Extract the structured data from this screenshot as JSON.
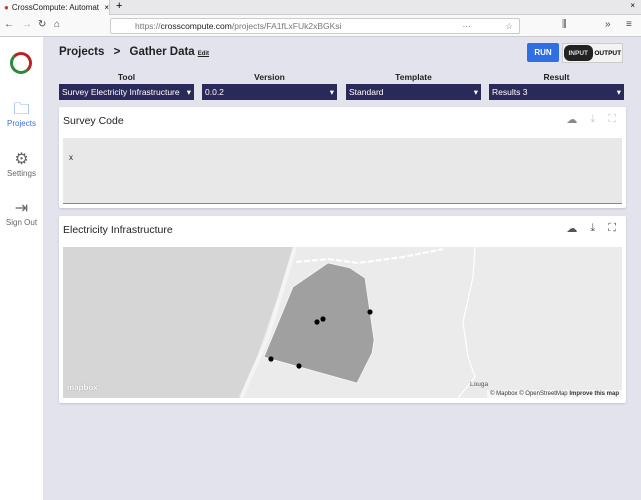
{
  "browser": {
    "tab_title": "CrossCompute: Automat",
    "url_host": "crosscompute.com",
    "url_prefix": "https://",
    "url_path": "/projects/FA1fLxFUk2xBGKsi"
  },
  "sidebar": {
    "items": [
      {
        "label": "Projects",
        "icon": "folder-icon",
        "active": true
      },
      {
        "label": "Settings",
        "icon": "gear-icon"
      },
      {
        "label": "Sign Out",
        "icon": "sign-out-icon"
      }
    ]
  },
  "header": {
    "breadcrumb_root": "Projects",
    "separator": ">",
    "page_title": "Gather Data",
    "edit_label": "Edit",
    "run_label": "RUN",
    "input_label": "INPUT",
    "output_label": "OUTPUT"
  },
  "selectors": [
    {
      "label": "Tool",
      "value": "Survey Electricity Infrastructure"
    },
    {
      "label": "Version",
      "value": "0.0.2"
    },
    {
      "label": "Template",
      "value": "Standard"
    },
    {
      "label": "Result",
      "value": "Results 3"
    }
  ],
  "survey_card": {
    "title": "Survey Code",
    "value": "x"
  },
  "map_card": {
    "title": "Electricity Infrastructure",
    "place_label": "Louga",
    "logo": "mapbox",
    "attribution": "© Mapbox © OpenStreetMap",
    "improve_link": "Improve this map"
  },
  "colors": {
    "accent": "#2f6fe3",
    "select_bg": "#2a2a5a",
    "polygon": "#a0a0a0"
  }
}
